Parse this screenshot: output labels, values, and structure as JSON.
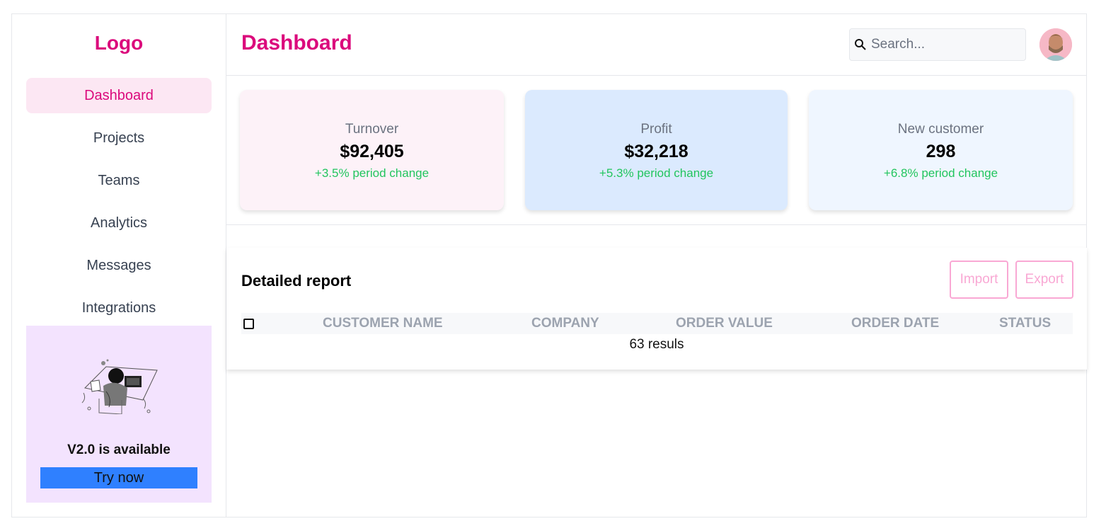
{
  "sidebar": {
    "logo": "Logo",
    "items": [
      {
        "label": "Dashboard",
        "active": true
      },
      {
        "label": "Projects"
      },
      {
        "label": "Teams"
      },
      {
        "label": "Analytics"
      },
      {
        "label": "Messages"
      },
      {
        "label": "Integrations"
      }
    ],
    "promo": {
      "title": "V2.0 is available",
      "button": "Try now"
    }
  },
  "header": {
    "title": "Dashboard",
    "search_placeholder": "Search..."
  },
  "stats": [
    {
      "label": "Turnover",
      "value": "$92,405",
      "change": "+3.5% period change",
      "bg": "#fdf2f8"
    },
    {
      "label": "Profit",
      "value": "$32,218",
      "change": "+5.3% period change",
      "bg": "#dbeafe"
    },
    {
      "label": "New customer",
      "value": "298",
      "change": "+6.8% period change",
      "bg": "#eff6ff"
    }
  ],
  "report": {
    "title": "Detailed report",
    "import_label": "Import",
    "export_label": "Export",
    "columns": [
      "CUSTOMER NAME",
      "COMPANY",
      "ORDER VALUE",
      "ORDER DATE",
      "STATUS"
    ],
    "results_text": "63 resuls"
  },
  "colors": {
    "brand": "#db0a7c",
    "positive": "#22c55e",
    "primary_button": "#2f80ff",
    "promo_bg": "#f3e3fe"
  }
}
